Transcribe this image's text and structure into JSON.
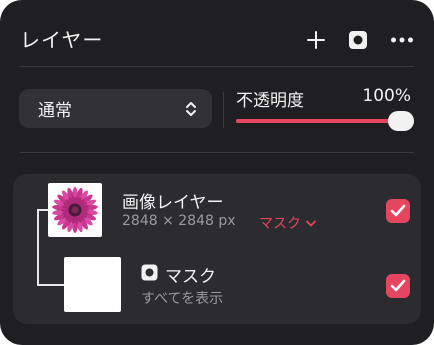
{
  "panel": {
    "title": "レイヤー",
    "icons": {
      "add": "plus-icon",
      "mask": "layer-mask-icon",
      "more": "ellipsis-icon"
    }
  },
  "blend_mode": {
    "label": "通常",
    "icon": "chevron-up-down-icon"
  },
  "opacity": {
    "label": "不透明度",
    "value_text": "100%",
    "value": 1.0
  },
  "layers": [
    {
      "name": "画像レイヤー",
      "size": "2848 × 2848 px",
      "mask_link": "マスク",
      "thumbnail": "pink-daisy-flower-image",
      "checked": true
    },
    {
      "name": "マスク",
      "subtitle": "すべてを表示",
      "icon": "mask-icon",
      "thumbnail": "white-mask",
      "checked": true
    }
  ],
  "colors": {
    "accent": "#e5455f",
    "panel_bg": "#1f1f21",
    "layer_bg": "#2c2c30",
    "control_bg": "#323236",
    "secondary_text": "#9a9a9e"
  }
}
